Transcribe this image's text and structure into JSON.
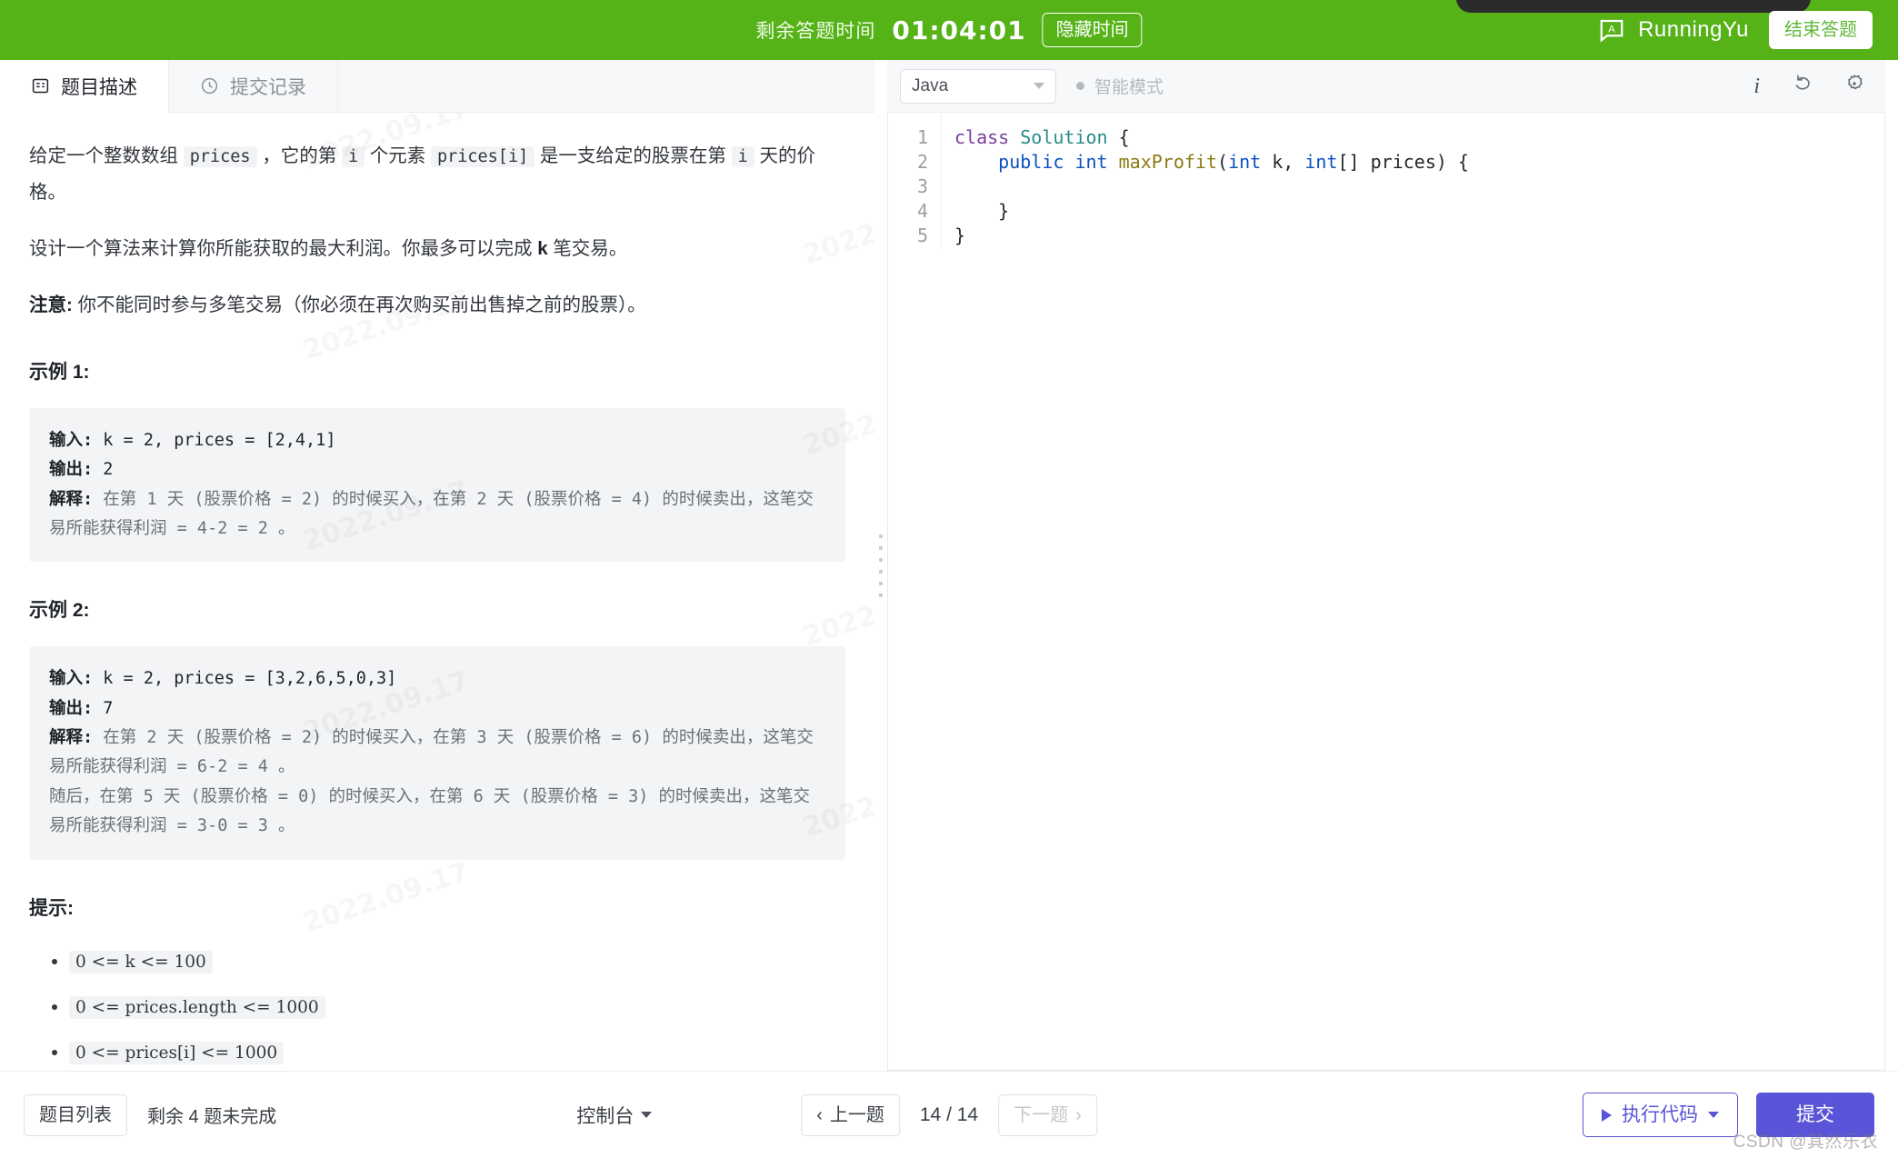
{
  "topbar": {
    "timer_label": "剩余答题时间",
    "timer_value": "01:04:01",
    "hide_time_label": "隐藏时间",
    "username": "RunningYu",
    "finish_label": "结束答题",
    "bg_color": "#55b217"
  },
  "tabs": [
    {
      "label": "题目描述",
      "icon": "description-icon",
      "active": true
    },
    {
      "label": "提交记录",
      "icon": "clock-icon",
      "active": false
    }
  ],
  "problem": {
    "para1": {
      "t1": "给定一个整数数组 ",
      "c1": "prices",
      "t2": " ，它的第 ",
      "c2": "i",
      "t3": " 个元素 ",
      "c3": "prices[i]",
      "t4": " 是一支给定的股票在第 ",
      "c4": "i",
      "t5": " 天的价格。"
    },
    "para2_a": "设计一个算法来计算你所能获取的最大利润。你最多可以完成 ",
    "para2_b": "k",
    "para2_c": " 笔交易。",
    "note_label": "注意:",
    "note_text": " 你不能同时参与多笔交易（你必须在再次购买前出售掉之前的股票）。",
    "example1_title": "示例 1:",
    "example1": {
      "in_label": "输入:",
      "in_value": " k = 2, prices = [2,4,1]",
      "out_label": "输出:",
      "out_value": " 2",
      "exp_label": "解释:",
      "exp_value": " 在第 1 天 (股票价格 = 2) 的时候买入，在第 2 天 (股票价格 = 4) 的时候卖出，这笔交易所能获得利润 = 4-2 = 2 。"
    },
    "example2_title": "示例 2:",
    "example2": {
      "in_label": "输入:",
      "in_value": " k = 2, prices = [3,2,6,5,0,3]",
      "out_label": "输出:",
      "out_value": " 7",
      "exp_label": "解释:",
      "exp_value": " 在第 2 天 (股票价格 = 2) 的时候买入，在第 3 天 (股票价格 = 6) 的时候卖出，这笔交易所能获得利润 = 6-2 = 4 。",
      "exp_value2": "     随后，在第 5 天 (股票价格 = 0) 的时候买入，在第 6 天 (股票价格 = 3) 的时候卖出，这笔交易所能获得利润 = 3-0 = 3 。"
    },
    "hints_title": "提示:",
    "hints": [
      "0 <= k <= 100",
      "0 <= prices.length <= 1000",
      "0 <= prices[i] <= 1000"
    ],
    "watermark": "2022.09.17"
  },
  "editor": {
    "language": "Java",
    "smart_mode_label": "智能模式",
    "line_numbers": [
      "1",
      "2",
      "3",
      "4",
      "5"
    ],
    "code_lines": [
      {
        "parts": [
          {
            "t": "class",
            "c": "kw"
          },
          {
            "t": " ",
            "c": "plain"
          },
          {
            "t": "Solution",
            "c": "typ"
          },
          {
            "t": " {",
            "c": "plain"
          }
        ]
      },
      {
        "parts": [
          {
            "t": "    ",
            "c": "plain"
          },
          {
            "t": "public",
            "c": "kw2"
          },
          {
            "t": " ",
            "c": "plain"
          },
          {
            "t": "int",
            "c": "kw2"
          },
          {
            "t": " ",
            "c": "plain"
          },
          {
            "t": "maxProfit",
            "c": "fn"
          },
          {
            "t": "(",
            "c": "plain"
          },
          {
            "t": "int",
            "c": "kw2"
          },
          {
            "t": " k, ",
            "c": "plain"
          },
          {
            "t": "int",
            "c": "kw2"
          },
          {
            "t": "[] prices) {",
            "c": "plain"
          }
        ]
      },
      {
        "parts": [
          {
            "t": "",
            "c": "plain"
          }
        ]
      },
      {
        "parts": [
          {
            "t": "    }",
            "c": "plain"
          }
        ]
      },
      {
        "parts": [
          {
            "t": "}",
            "c": "plain"
          }
        ]
      }
    ]
  },
  "bottombar": {
    "problem_list_label": "题目列表",
    "remaining_label": "剩余 4 题未完成",
    "prev_label": "上一题",
    "page_counter": "14 / 14",
    "next_label": "下一题",
    "console_label": "控制台",
    "run_label": "执行代码",
    "submit_label": "提交",
    "accent_color": "#5a54d8",
    "watermark": "CSDN @其然乐衣"
  }
}
